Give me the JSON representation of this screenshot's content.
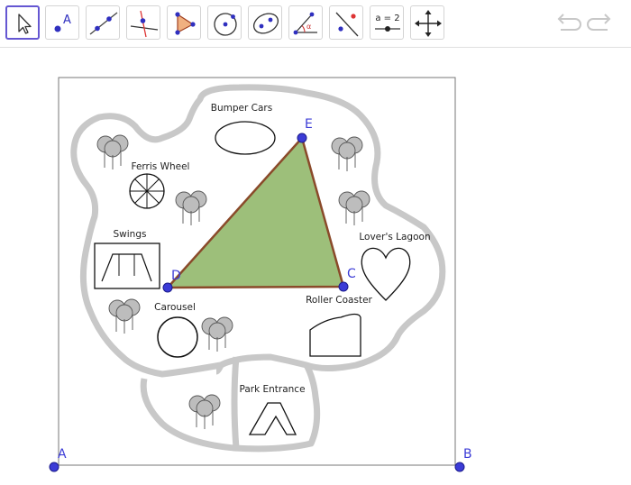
{
  "toolbar": {
    "tools": [
      {
        "name": "Move",
        "icon": "move-pointer-icon",
        "selected": true
      },
      {
        "name": "Point",
        "icon": "point-icon"
      },
      {
        "name": "Line",
        "icon": "line-icon"
      },
      {
        "name": "Perpendicular Line",
        "icon": "perpendicular-line-icon"
      },
      {
        "name": "Polygon",
        "icon": "polygon-icon"
      },
      {
        "name": "Circle with Center through Point",
        "icon": "circle-center-point-icon"
      },
      {
        "name": "Ellipse",
        "icon": "ellipse-icon"
      },
      {
        "name": "Angle",
        "icon": "angle-icon"
      },
      {
        "name": "Reflect about Line",
        "icon": "reflect-icon"
      },
      {
        "name": "Slider",
        "icon": "slider-icon",
        "label": "a = 2"
      },
      {
        "name": "Move Graphics View",
        "icon": "move-graphics-view-icon"
      }
    ],
    "undo_icon": "undo-icon",
    "redo_icon": "redo-icon"
  },
  "map": {
    "labels": {
      "bumper_cars": "Bumper Cars",
      "ferris_wheel": "Ferris Wheel",
      "swings": "Swings",
      "lovers_lagoon": "Lover's Lagoon",
      "roller_coaster": "Roller Coaster",
      "carousel": "Carousel",
      "park_entrance": "Park Entrance"
    }
  },
  "points": {
    "A": "A",
    "B": "B",
    "C": "C",
    "D": "D",
    "E": "E"
  },
  "colors": {
    "point": "#3b3bd6",
    "polygon_fill": "#9dbf7a",
    "polygon_stroke": "#8a4a2a",
    "path": "#c8c8c8",
    "selected_tool": "#6557d2"
  }
}
